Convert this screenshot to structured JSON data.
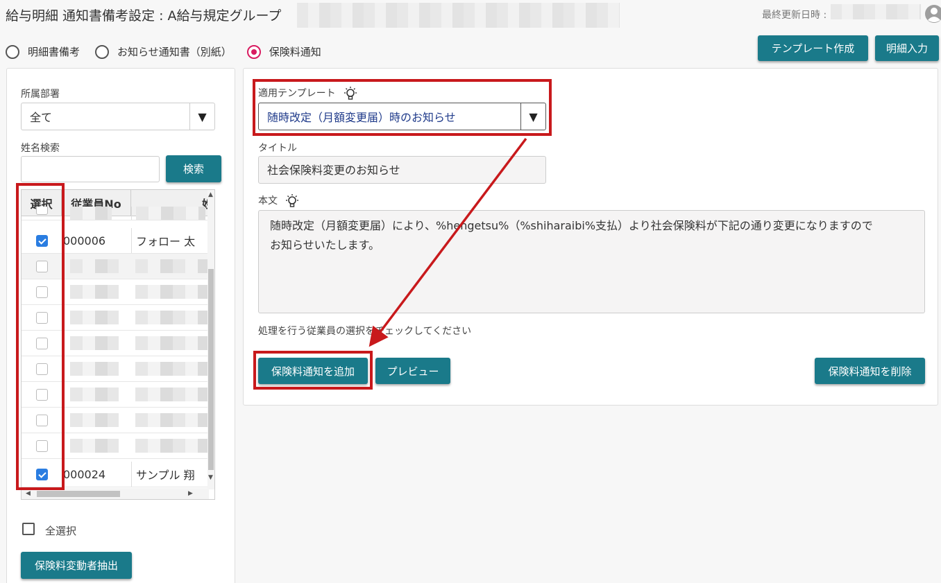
{
  "header": {
    "title": "給与明細 通知書備考設定 : A給与規定グループ",
    "last_updated_label": "最終更新日時 :"
  },
  "modes": [
    {
      "label": "明細書備考",
      "selected": false
    },
    {
      "label": "お知らせ通知書（別紙）",
      "selected": false
    },
    {
      "label": "保険料通知",
      "selected": true
    }
  ],
  "toolbar": {
    "create_template_label": "テンプレート作成",
    "detail_input_label": "明細入力"
  },
  "sidebar": {
    "department_label": "所属部署",
    "department_value": "全て",
    "name_search_label": "姓名検索",
    "name_search_value": "",
    "search_button": "検索",
    "select_all_label": "全選択",
    "extract_button": "保険料変動者抽出",
    "table": {
      "columns": [
        "選択",
        "従業員No",
        "姓名"
      ],
      "rows": [
        {
          "checked": false,
          "employee_no": "",
          "name": "",
          "masked": true
        },
        {
          "checked": true,
          "employee_no": "000006",
          "name": "フォロー 太",
          "masked": false
        },
        {
          "checked": false,
          "employee_no": "",
          "name": "",
          "masked": true
        },
        {
          "checked": false,
          "employee_no": "",
          "name": "",
          "masked": true
        },
        {
          "checked": false,
          "employee_no": "",
          "name": "",
          "masked": true
        },
        {
          "checked": false,
          "employee_no": "",
          "name": "",
          "masked": true
        },
        {
          "checked": false,
          "employee_no": "",
          "name": "",
          "masked": true
        },
        {
          "checked": false,
          "employee_no": "",
          "name": "",
          "masked": true
        },
        {
          "checked": false,
          "employee_no": "",
          "name": "",
          "masked": true
        },
        {
          "checked": false,
          "employee_no": "",
          "name": "",
          "masked": true
        },
        {
          "checked": true,
          "employee_no": "000024",
          "name": "サンプル 翔",
          "masked": false
        }
      ]
    }
  },
  "main": {
    "template_label": "適用テンプレート",
    "template_value": "随時改定（月額変更届）時のお知らせ",
    "title_label": "タイトル",
    "title_value": "社会保険料変更のお知らせ",
    "body_label": "本文",
    "body_line1": "随時改定（月額変更届）により、%hengetsu%（%shiharaibi%支払）より社会保険料が下記の通り変更になりますので",
    "body_line2": "お知らせいたします。",
    "instruction": "処理を行う従業員の選択をチェックしてください",
    "add_button": "保険料通知を追加",
    "preview_button": "プレビュー",
    "delete_button": "保険料通知を削除"
  },
  "colors": {
    "accent": "#1a7a8a",
    "highlight": "#c8191c",
    "radio_selected": "#d81b60",
    "checkbox_checked": "#2a7de1"
  }
}
